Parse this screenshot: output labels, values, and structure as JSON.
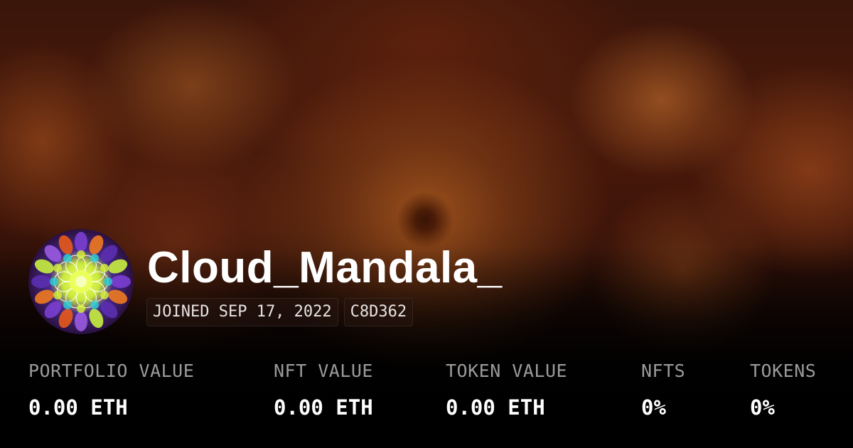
{
  "profile": {
    "name": "Cloud_Mandala_",
    "joined": "JOINED SEP 17, 2022",
    "address_tag": "C8D362",
    "avatar_icon": "mandala-avatar-icon"
  },
  "stats": [
    {
      "label": "PORTFOLIO VALUE",
      "value": "0.00 ETH"
    },
    {
      "label": "NFT VALUE",
      "value": "0.00 ETH"
    },
    {
      "label": "TOKEN VALUE",
      "value": "0.00 ETH"
    },
    {
      "label": "NFTS",
      "value": "0%"
    },
    {
      "label": "TOKENS",
      "value": "0%"
    }
  ],
  "colors": {
    "background": "#3a150a",
    "text": "#ffffff",
    "muted": "#9b9b9b"
  }
}
